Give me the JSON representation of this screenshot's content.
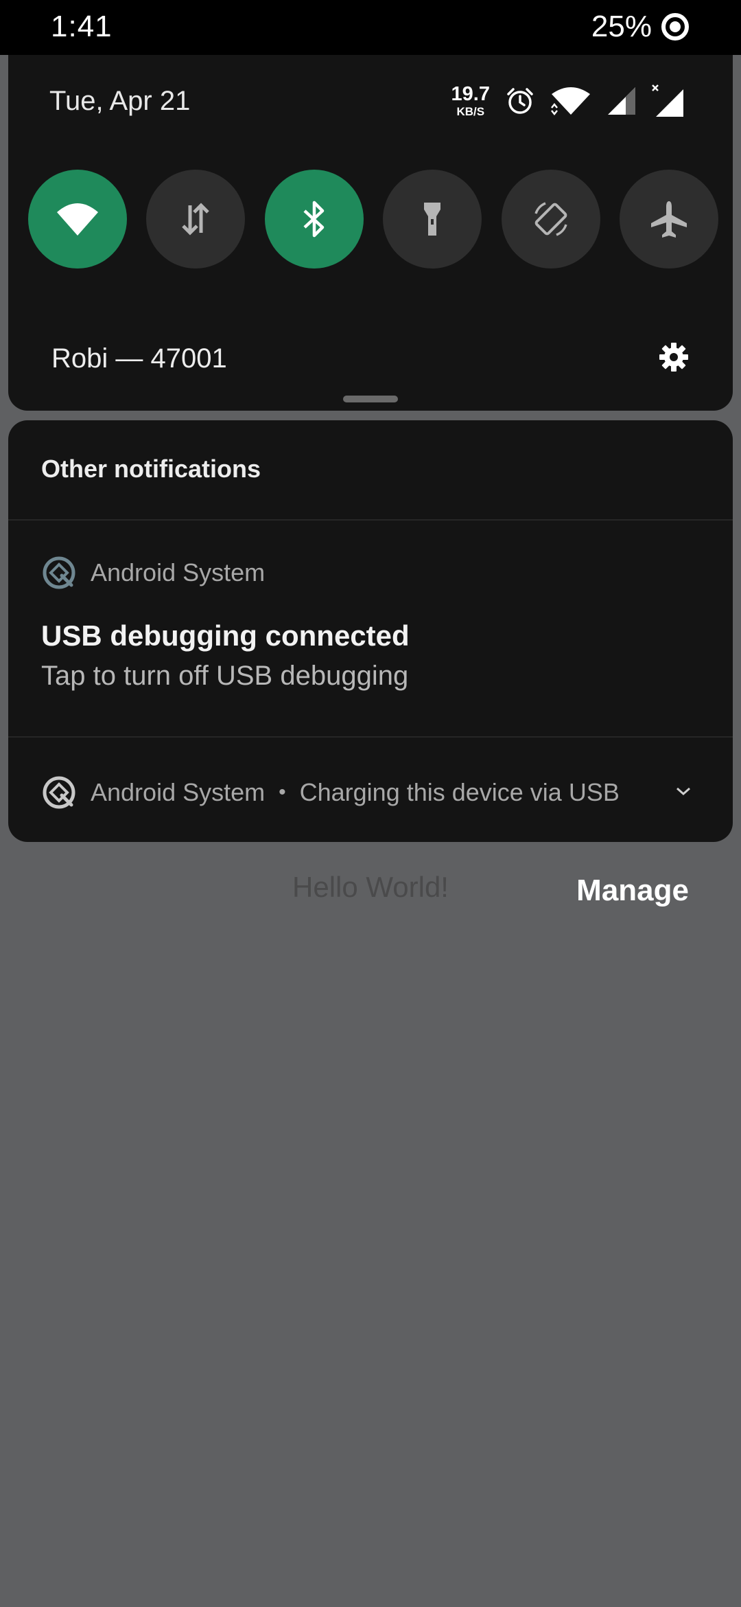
{
  "status_bar": {
    "time": "1:41",
    "battery_percent": "25%"
  },
  "quick_settings": {
    "date": "Tue, Apr 21",
    "net_speed_value": "19.7",
    "net_speed_unit": "KB/S",
    "carrier": "Robi — 47001",
    "accent_color": "#1f8a5b",
    "tiles": [
      {
        "name": "wifi",
        "icon": "wifi-icon",
        "active": true
      },
      {
        "name": "mobile-data",
        "icon": "data-arrows-icon",
        "active": false
      },
      {
        "name": "bluetooth",
        "icon": "bluetooth-icon",
        "active": true
      },
      {
        "name": "flashlight",
        "icon": "flashlight-icon",
        "active": false
      },
      {
        "name": "auto-rotate",
        "icon": "rotate-icon",
        "active": false
      },
      {
        "name": "airplane-mode",
        "icon": "airplane-icon",
        "active": false
      }
    ]
  },
  "notifications": {
    "header": "Other notifications",
    "items": [
      {
        "app": "Android System",
        "title": "USB debugging connected",
        "text": "Tap to turn off USB debugging"
      },
      {
        "app": "Android System",
        "summary": "Charging this device via USB"
      }
    ]
  },
  "background": {
    "hello_text": "Hello World!",
    "manage_label": "Manage"
  }
}
